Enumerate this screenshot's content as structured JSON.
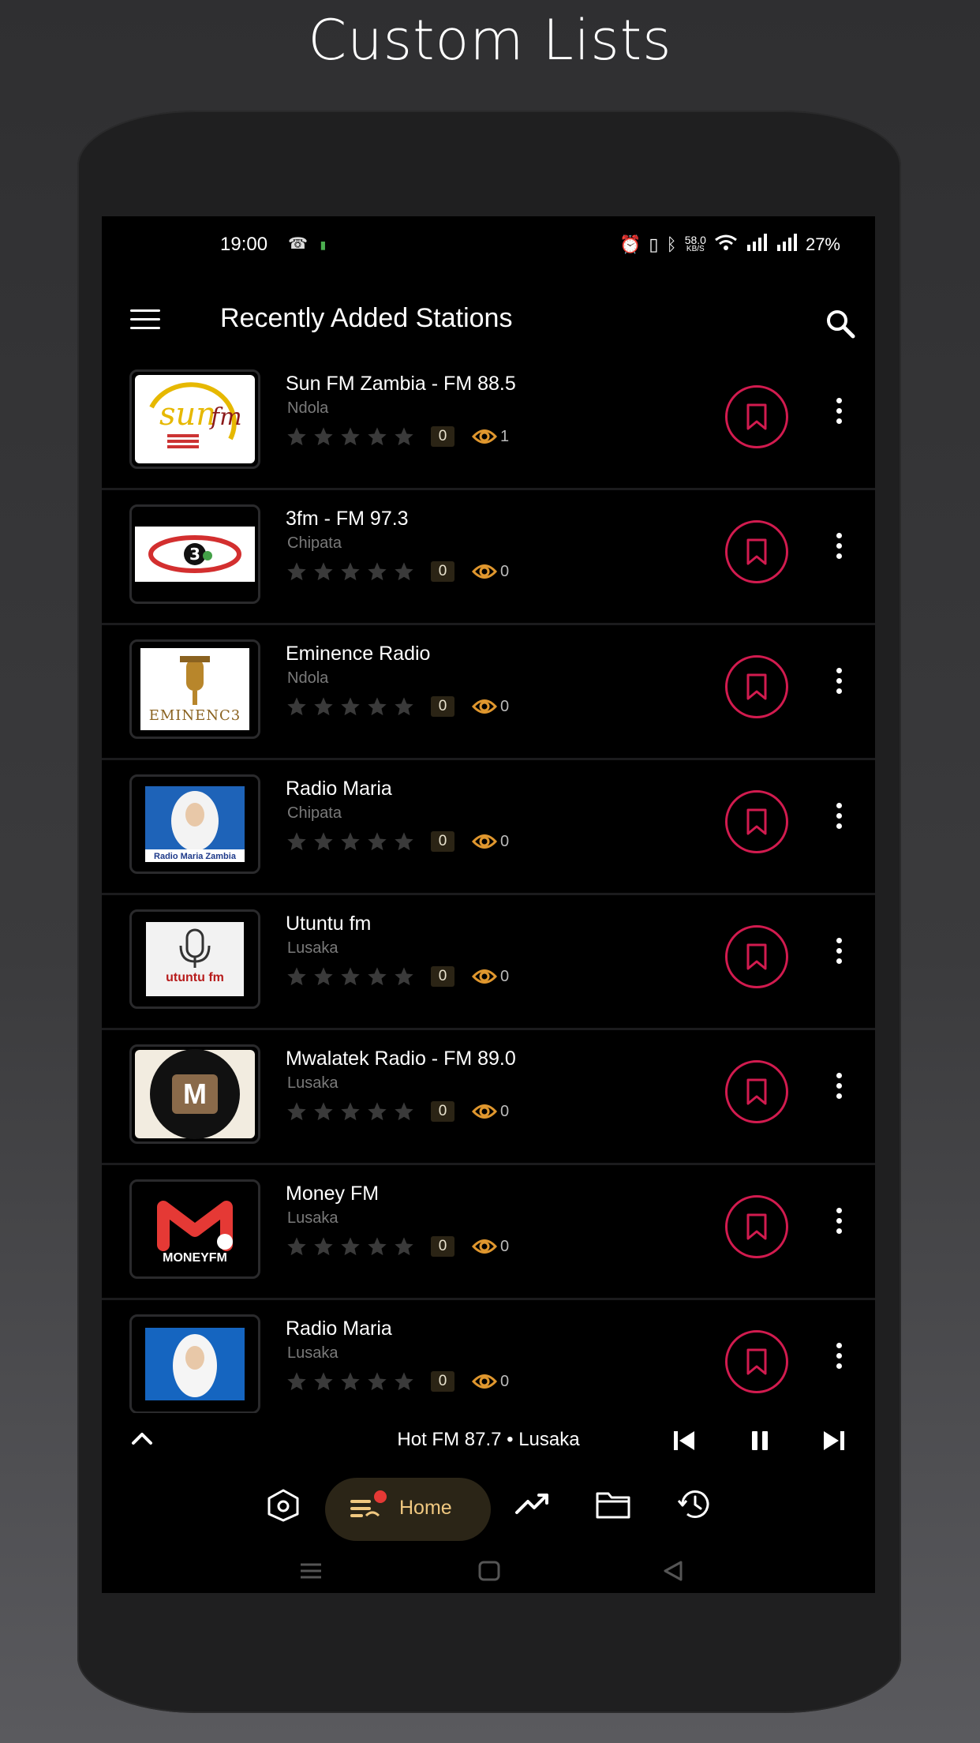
{
  "promo": {
    "title": "Custom Lists"
  },
  "status_bar": {
    "time": "19:00",
    "speed_value": "58.0",
    "speed_unit": "KB/S",
    "battery": "27%"
  },
  "app_bar": {
    "title": "Recently Added Stations"
  },
  "stations": [
    {
      "name": "Sun FM Zambia - FM 88.5",
      "city": "Ndola",
      "rating_count": "0",
      "views": "1",
      "logo": "sun-fm-logo"
    },
    {
      "name": "3fm - FM 97.3",
      "city": "Chipata",
      "rating_count": "0",
      "views": "0",
      "logo": "3fm-logo"
    },
    {
      "name": "Eminence Radio",
      "city": "Ndola",
      "rating_count": "0",
      "views": "0",
      "logo": "eminence-logo",
      "logo_text": "EMINENC3"
    },
    {
      "name": "Radio Maria",
      "city": "Chipata",
      "rating_count": "0",
      "views": "0",
      "logo": "radio-maria-logo",
      "logo_text": "Radio Maria Zambia"
    },
    {
      "name": "Utuntu fm",
      "city": "Lusaka",
      "rating_count": "0",
      "views": "0",
      "logo": "utuntu-logo",
      "logo_text": "utuntu fm"
    },
    {
      "name": "Mwalatek Radio - FM 89.0",
      "city": "Lusaka",
      "rating_count": "0",
      "views": "0",
      "logo": "mwalatek-logo",
      "logo_text": "M"
    },
    {
      "name": "Money FM",
      "city": "Lusaka",
      "rating_count": "0",
      "views": "0",
      "logo": "money-fm-logo",
      "logo_text": "MONEYFM"
    },
    {
      "name": "Radio Maria",
      "city": "Lusaka",
      "rating_count": "0",
      "views": "0",
      "logo": "radio-maria-lusaka-logo"
    }
  ],
  "player": {
    "now_playing": "Hot FM 87.7 • Lusaka"
  },
  "bottom_nav": {
    "home_label": "Home"
  },
  "colors": {
    "accent_pink": "#d21b4f",
    "home_pill": "#2b2517",
    "home_text": "#f0c880",
    "eye_orange": "#e0972e",
    "background": "#000000"
  }
}
